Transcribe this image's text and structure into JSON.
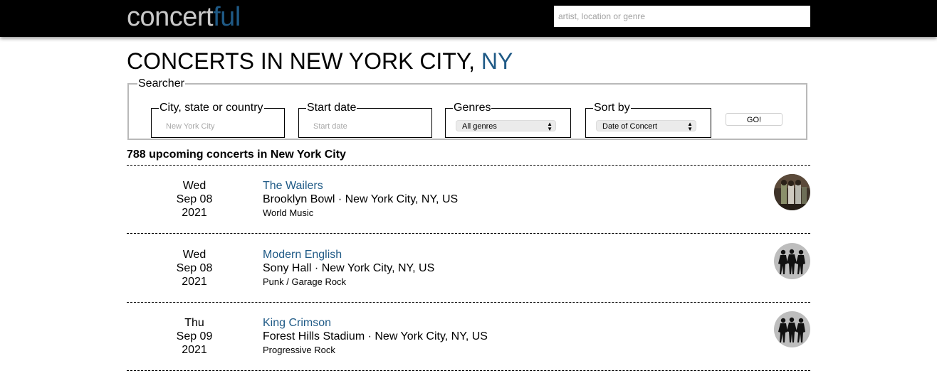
{
  "logo": {
    "part1": "concert",
    "part2": "ful"
  },
  "search": {
    "placeholder": "artist, location or genre"
  },
  "page_title": {
    "prefix": "CONCERTS IN NEW YORK CITY, ",
    "state": "NY"
  },
  "searcher": {
    "legend": "Searcher",
    "city": {
      "label": "City, state or country",
      "placeholder": "New York City"
    },
    "start_date": {
      "label": "Start date",
      "placeholder": "Start date"
    },
    "genres": {
      "label": "Genres",
      "selected": "All genres"
    },
    "sort": {
      "label": "Sort by",
      "selected": "Date of Concert"
    },
    "go_label": "GO!"
  },
  "results_count": "788 upcoming concerts in New York City",
  "concerts": [
    {
      "day": "Wed",
      "date": "Sep 08",
      "year": "2021",
      "artist": "The Wailers",
      "venue": "Brooklyn Bowl · New York City, NY, US",
      "genre": "World Music",
      "thumb": "band-photo"
    },
    {
      "day": "Wed",
      "date": "Sep 08",
      "year": "2021",
      "artist": "Modern English",
      "venue": "Sony Hall · New York City, NY, US",
      "genre": "Punk / Garage Rock",
      "thumb": "silhouette-placeholder"
    },
    {
      "day": "Thu",
      "date": "Sep 09",
      "year": "2021",
      "artist": "King Crimson",
      "venue": "Forest Hills Stadium · New York City, NY, US",
      "genre": "Progressive Rock",
      "thumb": "silhouette-placeholder"
    }
  ],
  "colors": {
    "accent": "#1f5a86",
    "topbar": "#000000",
    "logo_light": "#c9c9c9"
  }
}
